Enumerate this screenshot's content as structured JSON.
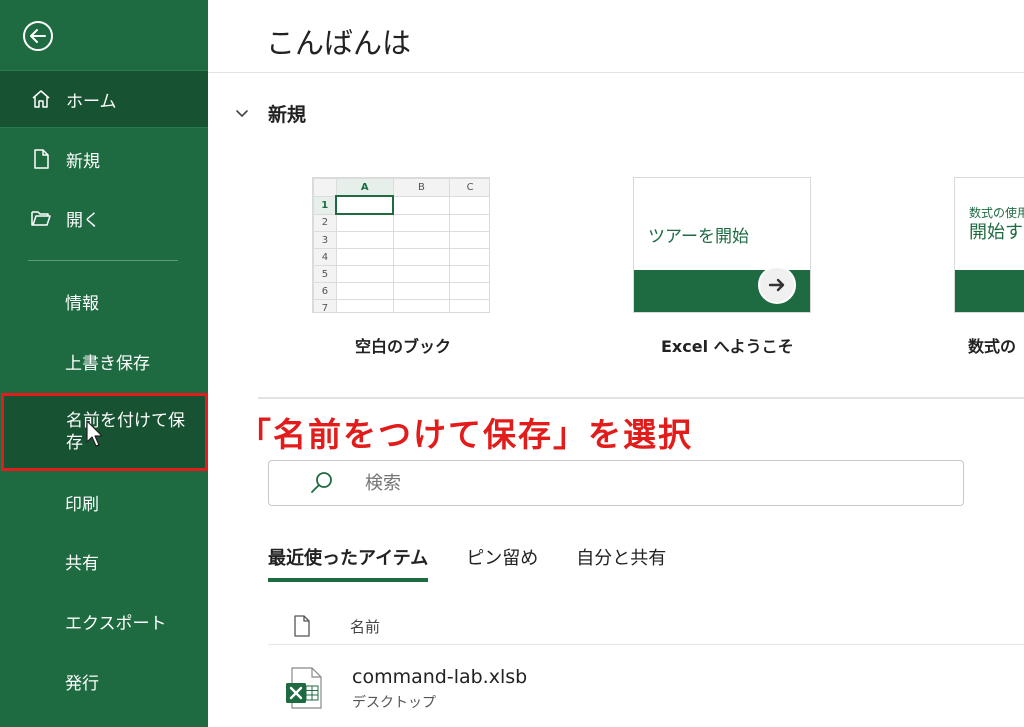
{
  "sidebar": {
    "back_label": "戻る",
    "items": [
      {
        "label": "ホーム",
        "icon": "home-icon"
      },
      {
        "label": "新規",
        "icon": "new-file-icon"
      },
      {
        "label": "開く",
        "icon": "open-folder-icon"
      },
      {
        "label": "情報"
      },
      {
        "label": "上書き保存"
      },
      {
        "label": "名前を付けて保存"
      },
      {
        "label": "印刷"
      },
      {
        "label": "共有"
      },
      {
        "label": "エクスポート"
      },
      {
        "label": "発行"
      }
    ]
  },
  "main": {
    "greeting": "こんばんは",
    "new_section": {
      "title": "新規",
      "templates": [
        {
          "label": "空白のブック",
          "columns": [
            "A",
            "B",
            "C"
          ],
          "rows": [
            "1",
            "2",
            "3",
            "4",
            "5",
            "6",
            "7"
          ]
        },
        {
          "label": "Excel へようこそ",
          "thumb_text": "ツアーを開始"
        },
        {
          "label": "数式の",
          "thumb_line1": "数式の使用",
          "thumb_line2": "開始す"
        }
      ]
    },
    "annotation": "「名前をつけて保存」を選択",
    "search": {
      "placeholder": "検索"
    },
    "tabs": [
      "最近使ったアイテム",
      "ピン留め",
      "自分と共有"
    ],
    "list_header": {
      "name_label": "名前"
    },
    "files": [
      {
        "name": "command-lab.xlsb",
        "location": "デスクトップ"
      }
    ]
  },
  "colors": {
    "sidebar_bg": "#1e6b41",
    "sidebar_selected": "#175232",
    "highlight_border": "#e21b1b",
    "annotation_text": "#e21b1b",
    "accent": "#1e6b41"
  }
}
